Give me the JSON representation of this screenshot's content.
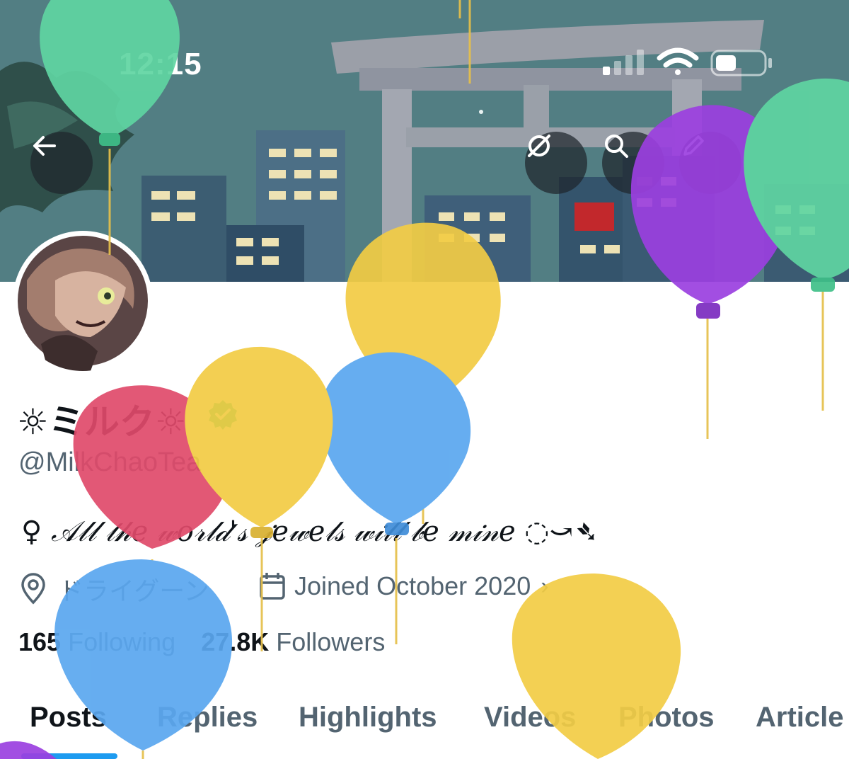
{
  "status_bar": {
    "time": "12:15"
  },
  "header": {
    "back_icon": "arrow-left-icon",
    "actions": [
      {
        "icon": "grok-icon"
      },
      {
        "icon": "search-icon"
      },
      {
        "icon": "edit-pencil-icon"
      }
    ]
  },
  "profile": {
    "name": "☼ミルク☼",
    "verified": true,
    "handle": "@MilkChaoTea",
    "bio": "♀ 𝒜𝓁𝓁 𝓉𝒽𝑒 𝓌𝑜𝓇𝓁𝒹'𝓈 𝒿𝑒𝓌𝑒𝓁𝓈 𝓌𝒾𝓁𝓁 𝒷𝑒 𝓂𝒾𝓃𝑒 ◌⤻➴",
    "location": "ドライグーン",
    "joined": "Joined October 2020",
    "following_count": "165",
    "following_label": "Following",
    "followers_count": "27.8K",
    "followers_label": "Followers"
  },
  "tabs": [
    {
      "label": "Posts",
      "active": true
    },
    {
      "label": "Replies"
    },
    {
      "label": "Highlights"
    },
    {
      "label": "Videos"
    },
    {
      "label": "Photos"
    },
    {
      "label": "Article"
    }
  ],
  "colors": {
    "accent": "#1d9bf0",
    "text": "#0f1419",
    "secondary": "#536471",
    "verified": "#00ba7c"
  }
}
